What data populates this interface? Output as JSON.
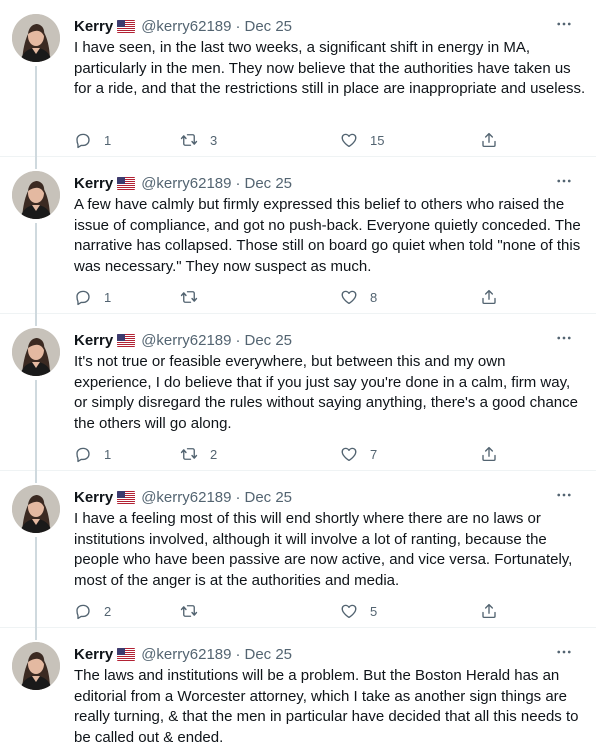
{
  "tweets": [
    {
      "name": "Kerry",
      "handle": "@kerry62189",
      "separator": "·",
      "date": "Dec 25",
      "text": "I have seen, in the last two weeks, a significant shift in energy in MA, particularly in the men. They now believe that the authorities have taken us for a ride, and that the restrictions still in place are inappropriate and useless.",
      "replies": "1",
      "retweets": "3",
      "likes": "15"
    },
    {
      "name": "Kerry",
      "handle": "@kerry62189",
      "separator": "·",
      "date": "Dec 25",
      "text": "A few have calmly but firmly expressed this belief to others who raised the issue of compliance, and got no push-back. Everyone quietly conceded. The narrative has collapsed. Those still on board go quiet when told \"none of this was necessary.\" They now suspect as much.",
      "replies": "1",
      "retweets": "",
      "likes": "8"
    },
    {
      "name": "Kerry",
      "handle": "@kerry62189",
      "separator": "·",
      "date": "Dec 25",
      "text": "It's not true or feasible everywhere, but between this and my own experience, I do believe that if you just say you're done in a calm, firm way, or simply disregard the rules without saying anything, there's a good chance the others will go along.",
      "replies": "1",
      "retweets": "2",
      "likes": "7"
    },
    {
      "name": "Kerry",
      "handle": "@kerry62189",
      "separator": "·",
      "date": "Dec 25",
      "text": "I have a feeling most of this will end shortly where there are no laws or institutions involved, although it will involve a lot of ranting, because the people who have been passive are now active, and vice versa. Fortunately, most of the anger is at the authorities and media.",
      "replies": "2",
      "retweets": "",
      "likes": "5"
    },
    {
      "name": "Kerry",
      "handle": "@kerry62189",
      "separator": "·",
      "date": "Dec 25",
      "text": "The laws and institutions will be a problem. But the Boston Herald has an editorial from a Worcester attorney, which I take as another sign things are really turning, & that the men in particular have decided that all this needs to be called out & ended."
    }
  ],
  "icons": {
    "author_flag": "us-flag-icon",
    "more": "more-icon",
    "reply": "reply-icon",
    "retweet": "retweet-icon",
    "like": "like-icon",
    "share": "share-icon"
  },
  "colors": {
    "primary_text": "#0f1419",
    "secondary_text": "#536471",
    "thread_line": "#cfd9de",
    "divider": "#eff3f4"
  }
}
